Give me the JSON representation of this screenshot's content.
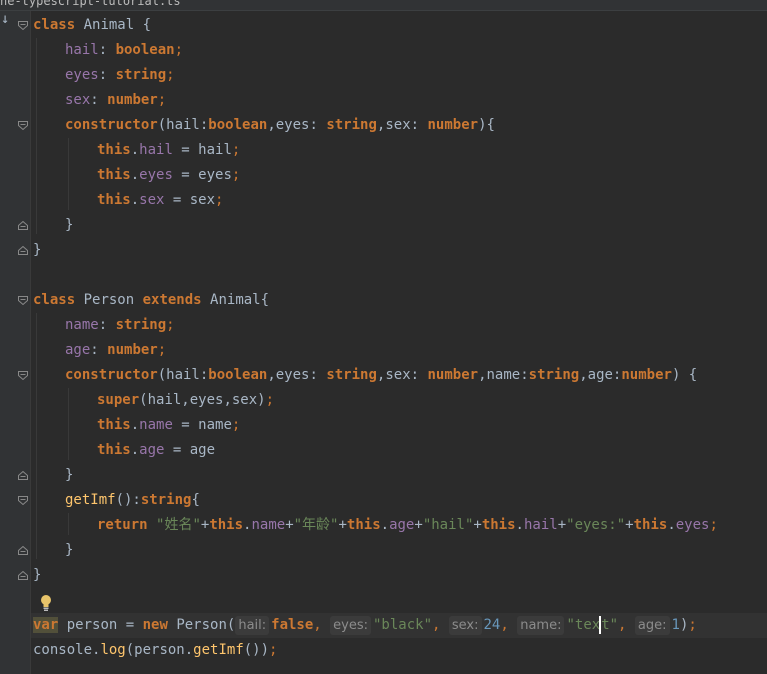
{
  "window": {
    "path_fragment": "ne-typescript-tutorial.ts"
  },
  "code": {
    "l1_class": "class",
    "l1_name": " Animal ",
    "l1_brace": "{",
    "l2_f": "hail",
    "l2_c": ": ",
    "l2_t": "boolean",
    "l2_s": ";",
    "l3_f": "eyes",
    "l3_c": ": ",
    "l3_t": "string",
    "l3_s": ";",
    "l4_f": "sex",
    "l4_c": ": ",
    "l4_t": "number",
    "l4_s": ";",
    "l5_kw": "constructor",
    "l5_a": "(hail:",
    "l5_t1": "boolean",
    "l5_b": ",eyes: ",
    "l5_t2": "string",
    "l5_c": ",sex: ",
    "l5_t3": "number",
    "l5_d": "){",
    "l6_this": "this",
    "l6_dot": ".",
    "l6_f": "hail",
    "l6_rest": " = hail",
    "l6_s": ";",
    "l7_this": "this",
    "l7_dot": ".",
    "l7_f": "eyes",
    "l7_rest": " = eyes",
    "l7_s": ";",
    "l8_this": "this",
    "l8_dot": ".",
    "l8_f": "sex",
    "l8_rest": " = sex",
    "l8_s": ";",
    "l9": "}",
    "l10": "}",
    "l12_class": "class",
    "l12_name": " Person ",
    "l12_ext": "extends",
    "l12_base": " Animal{",
    "l13_f": "name",
    "l13_c": ": ",
    "l13_t": "string",
    "l13_s": ";",
    "l14_f": "age",
    "l14_c": ": ",
    "l14_t": "number",
    "l14_s": ";",
    "l15_kw": "constructor",
    "l15_a": "(hail:",
    "l15_t1": "boolean",
    "l15_b": ",eyes: ",
    "l15_t2": "string",
    "l15_c": ",sex: ",
    "l15_t3": "number",
    "l15_d": ",name:",
    "l15_t4": "string",
    "l15_e": ",age:",
    "l15_t5": "number",
    "l15_f": ") {",
    "l16_super": "super",
    "l16_args": "(hail,eyes,sex)",
    "l16_s": ";",
    "l17_this": "this",
    "l17_dot": ".",
    "l17_f": "name",
    "l17_rest": " = name",
    "l17_s": ";",
    "l18_this": "this",
    "l18_dot": ".",
    "l18_f": "age",
    "l18_rest": " = age",
    "l19": "}",
    "l20_fn": "getImf",
    "l20_a": "():",
    "l20_t": "string",
    "l20_b": "{",
    "l21_ret": "return ",
    "l21_s1": "\"姓名\"",
    "l21_p1": "+",
    "l21_this1": "this",
    "l21_dot1": ".",
    "l21_f1": "name",
    "l21_p2": "+",
    "l21_s2": "\"年龄\"",
    "l21_p3": "+",
    "l21_this2": "this",
    "l21_dot2": ".",
    "l21_f2": "age",
    "l21_p4": "+",
    "l21_s3": "\"hail\"",
    "l21_p5": "+",
    "l21_this3": "this",
    "l21_dot3": ".",
    "l21_f3": "hail",
    "l21_p6": "+",
    "l21_s4": "\"eyes:\"",
    "l21_p7": "+",
    "l21_this4": "this",
    "l21_dot4": ".",
    "l21_f4": "eyes",
    "l21_s": ";",
    "l22": "}",
    "l23": "}",
    "l25_var": "var",
    "l25_name": " person = ",
    "l25_new": "new",
    "l25_cls": " Person(",
    "l25_h1": "hail:",
    "l25_v1": "false",
    "l25_c1": ", ",
    "l25_h2": "eyes:",
    "l25_v2": "\"black\"",
    "l25_c2": ", ",
    "l25_h3": "sex:",
    "l25_v3": "24",
    "l25_c3": ", ",
    "l25_h4": "name:",
    "l25_v4a": "\"tex",
    "l25_v4b": "t\"",
    "l25_c4": ", ",
    "l25_h5": "age:",
    "l25_v5": "1",
    "l25_end": ")",
    "l25_s": ";",
    "l26_obj": "console.",
    "l26_fn": "log",
    "l26_a": "(person.",
    "l26_fn2": "getImf",
    "l26_b": "())",
    "l26_s": ";"
  },
  "colors": {
    "background": "#2b2b2b",
    "keyword": "#cc7832",
    "field": "#9876aa",
    "string": "#6a8759",
    "number": "#6897bb",
    "function": "#ffc66d",
    "text": "#a9b7c6"
  }
}
